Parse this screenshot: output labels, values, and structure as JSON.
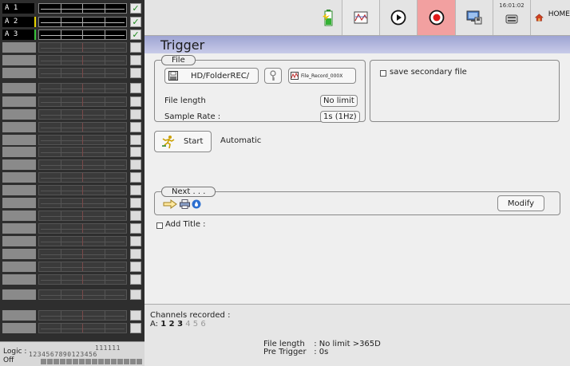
{
  "channels": {
    "active": [
      {
        "label": "A 1"
      },
      {
        "label": "A 2"
      },
      {
        "label": "A 3"
      }
    ],
    "inactive_count": 22
  },
  "logic": {
    "label": "Logic :",
    "state": "Off",
    "top_digits": "111111",
    "numbers": "1234567890123456"
  },
  "toolbar": {
    "clock": "16:01:02",
    "home_label": "HOME"
  },
  "page": {
    "title": "Trigger"
  },
  "file_group": {
    "legend": "File",
    "folder": "HD/FolderREC/",
    "filename": "File_Record_000X",
    "file_length_label": "File length",
    "file_length_value": "No limit",
    "sample_rate_label": "Sample Rate :",
    "sample_rate_value": "1s (1Hz)"
  },
  "secondary": {
    "label": "save secondary file",
    "checked": false
  },
  "start": {
    "label": "Start",
    "mode": "Automatic"
  },
  "next_group": {
    "legend": "Next . . .",
    "modify_label": "Modify"
  },
  "add_title": {
    "label": "Add Title :",
    "checked": false
  },
  "status": {
    "channels_recorded_label": "Channels recorded :",
    "prefix": "A:",
    "recorded": [
      "1",
      "2",
      "3"
    ],
    "not_recorded": [
      "4",
      "5",
      "6"
    ],
    "file_length_name": "File length",
    "file_length_value": ": No limit >365D",
    "pre_trigger_name": "Pre Trigger",
    "pre_trigger_value": ": 0s"
  },
  "colors": {
    "title_bar": "#9ea4d2",
    "record_active": "#f2a0a0",
    "check_green": "#1b8a1b",
    "a2_trace": "#e8d400",
    "a3_trace": "#39c23a"
  }
}
